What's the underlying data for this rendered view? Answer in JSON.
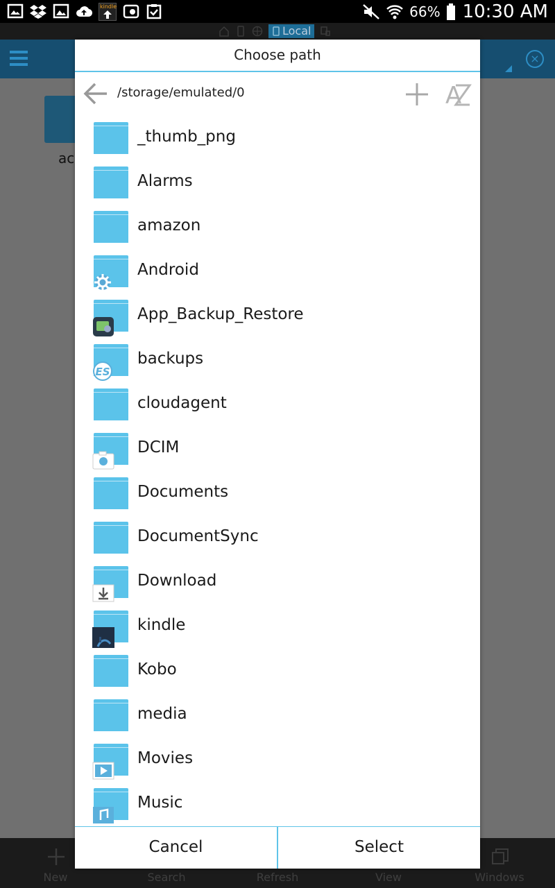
{
  "status_bar": {
    "icons_left": [
      "gallery-notification-icon",
      "dropbox-icon",
      "image-icon",
      "cloud-upload-icon",
      "kindle-icon",
      "photo-edit-icon",
      "clipboard-check-icon"
    ],
    "kindle_badge_text": "kindle",
    "battery_percent": "66%",
    "time": "10:30 AM"
  },
  "app": {
    "location_chip": "Local",
    "bg_folder_label": "ac",
    "bottom_nav": [
      {
        "label": "New",
        "icon": "plus-icon"
      },
      {
        "label": "Search",
        "icon": "search-icon"
      },
      {
        "label": "Refresh",
        "icon": "refresh-icon"
      },
      {
        "label": "View",
        "icon": "view-icon"
      },
      {
        "label": "Windows",
        "icon": "windows-icon"
      }
    ]
  },
  "dialog": {
    "title": "Choose path",
    "path": "/storage/emulated/0",
    "folders": [
      {
        "name": "_thumb_png",
        "badge": ""
      },
      {
        "name": "Alarms",
        "badge": ""
      },
      {
        "name": "amazon",
        "badge": ""
      },
      {
        "name": "Android",
        "badge": "gear"
      },
      {
        "name": "App_Backup_Restore",
        "badge": "backup-app"
      },
      {
        "name": "backups",
        "badge": "es"
      },
      {
        "name": "cloudagent",
        "badge": ""
      },
      {
        "name": "DCIM",
        "badge": "camera"
      },
      {
        "name": "Documents",
        "badge": ""
      },
      {
        "name": "DocumentSync",
        "badge": ""
      },
      {
        "name": "Download",
        "badge": "download"
      },
      {
        "name": "kindle",
        "badge": "kindle"
      },
      {
        "name": "Kobo",
        "badge": ""
      },
      {
        "name": "media",
        "badge": ""
      },
      {
        "name": "Movies",
        "badge": "play"
      },
      {
        "name": "Music",
        "badge": "music"
      }
    ],
    "cancel_label": "Cancel",
    "select_label": "Select",
    "kindle_badge_text": "kindle",
    "es_badge_text": "ES"
  },
  "colors": {
    "accent": "#5fc4e8",
    "folder": "#5bc3ea",
    "toolbar": "#164e70"
  }
}
